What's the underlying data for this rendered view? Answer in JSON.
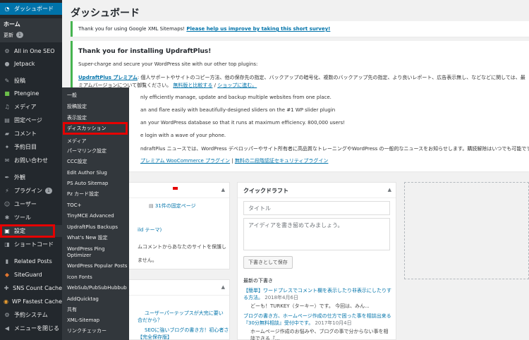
{
  "sidebar": {
    "dashboard": "ダッシュボード",
    "home": "ホーム",
    "updates": "更新",
    "updates_count": "1",
    "aioseo": "All in One SEO",
    "jetpack": "Jetpack",
    "posts": "投稿",
    "ptengine": "Ptengine",
    "media": "メディア",
    "pages": "固定ページ",
    "comments": "コメント",
    "schedule": "予約日目",
    "contact": "お問い合わせ",
    "appearance": "外観",
    "plugins": "プラグイン",
    "plugins_count": "1",
    "users": "ユーザー",
    "tools": "ツール",
    "settings": "設定",
    "shortcode": "ショートコード",
    "related_posts": "Related Posts",
    "siteguard": "SiteGuard",
    "sns_count": "SNS Count Cache",
    "wp_fastest": "WP Fastest Cache",
    "reservation": "予約システム",
    "collapse": "メニューを閉じる"
  },
  "flyout": {
    "items": [
      "一般",
      "投稿設定",
      "表示設定",
      "ディスカッション",
      "メディア",
      "パーマリンク設定",
      "CCC設定",
      "Edit Author Slug",
      "PS Auto Sitemap",
      "Pz カード設定",
      "TOC+",
      "TinyMCE Advanced",
      "UpdraftPlus Backups",
      "What's New 設定",
      "WordPress Ping",
      "Optimizer",
      "WordPress Popular Posts",
      "Icon Fonts",
      "WebSub/PubSubHubbub",
      "AddQuicktag",
      "共有",
      "XML-Sitemap",
      "リンクチェッカー"
    ]
  },
  "main": {
    "title": "ダッシュボード",
    "notice1_text": "Thank you for using Google XML Sitemaps!",
    "notice1_link": "Please help us improve by taking this short survey!",
    "notice2_title": "Thank you for installing UpdraftPlus!",
    "notice2_intro": "Super-charge and secure your WordPress site with our other top plugins:",
    "notice2_premium_link": "UpdraftPlus プレミアム",
    "notice2_premium_text": ": 個人サポートやサイトのコピー方法、他の保存先の指定、バックアップの暗号化、複数のバックアップ先の指定、より良いレポート、広告表示無し、などなどに関しては、最",
    "notice2_line2_text": "ミアムバージョンについて御覧ください。",
    "notice2_compare": "無料版と比較する",
    "notice2_shop": "ショップに進む。",
    "notice2_line3": "nly efficiently manage, update and backup multiple websites from one place.",
    "notice2_line4": "an and flare easily with beautifully-designed sliders on the #1 WP slider plugin",
    "notice2_line5": "an your WordPress database so that it runs at maximum efficiency. 800,000 users!",
    "notice2_line6": "e login with a wave of your phone.",
    "notice2_line7": "ndraftPlus ニュースでは、WordPress デベロッパーやサイト所有者に高品質なトレーニングやWordPress の一般的なニュースをお知らせします。購読解除はいつでも可能です。",
    "notice2_line8_a": "プレミアム WooCommerce プラグイン",
    "notice2_line8_b": "無料の二段階認証セキュリティプラグイン",
    "glance_pages": "31件の固定ページ",
    "glance_theme": "ild テーマ)",
    "glance_text1": "ムコメントからあなたのサイトを保護し",
    "glance_text2": "ません。",
    "activity_post1": "ユーザーパーテップスが大完に要い",
    "activity_post1b": "合だから？",
    "activity_post2": "SEOに強いブログの書き方！初心者さ",
    "activity_post2b": "【完全保存版】"
  },
  "quickdraft": {
    "title": "クイックドラフト",
    "title_placeholder": "タイトル",
    "content_placeholder": "アイディアを書き留めてみましょう。",
    "save_button": "下書きとして保存",
    "recent_drafts": "最新の下書き",
    "draft1_title": "【簡単】ワードプレスでコメント欄を表示したり非表示にしたりする方法。",
    "draft1_date": "2018年4月6日",
    "draft1_excerpt": "どーも！TURKEY（ターキー）です。 今回は、みん...",
    "draft2_title": "ブログの書き方、ホームページ作成の仕方で困った事を相談出来る『30分無料相談』受付中です。",
    "draft2_date": "2017年10月4日",
    "draft2_excerpt": "ホームページ作成のお悩みや、ブログの事で分からない事を相談できる『..."
  },
  "colors": {
    "sidebar_bg": "#23282d",
    "flyout_bg": "#32373c",
    "highlight": "#e60000",
    "link": "#0073aa",
    "notice_border": "#46b450"
  }
}
